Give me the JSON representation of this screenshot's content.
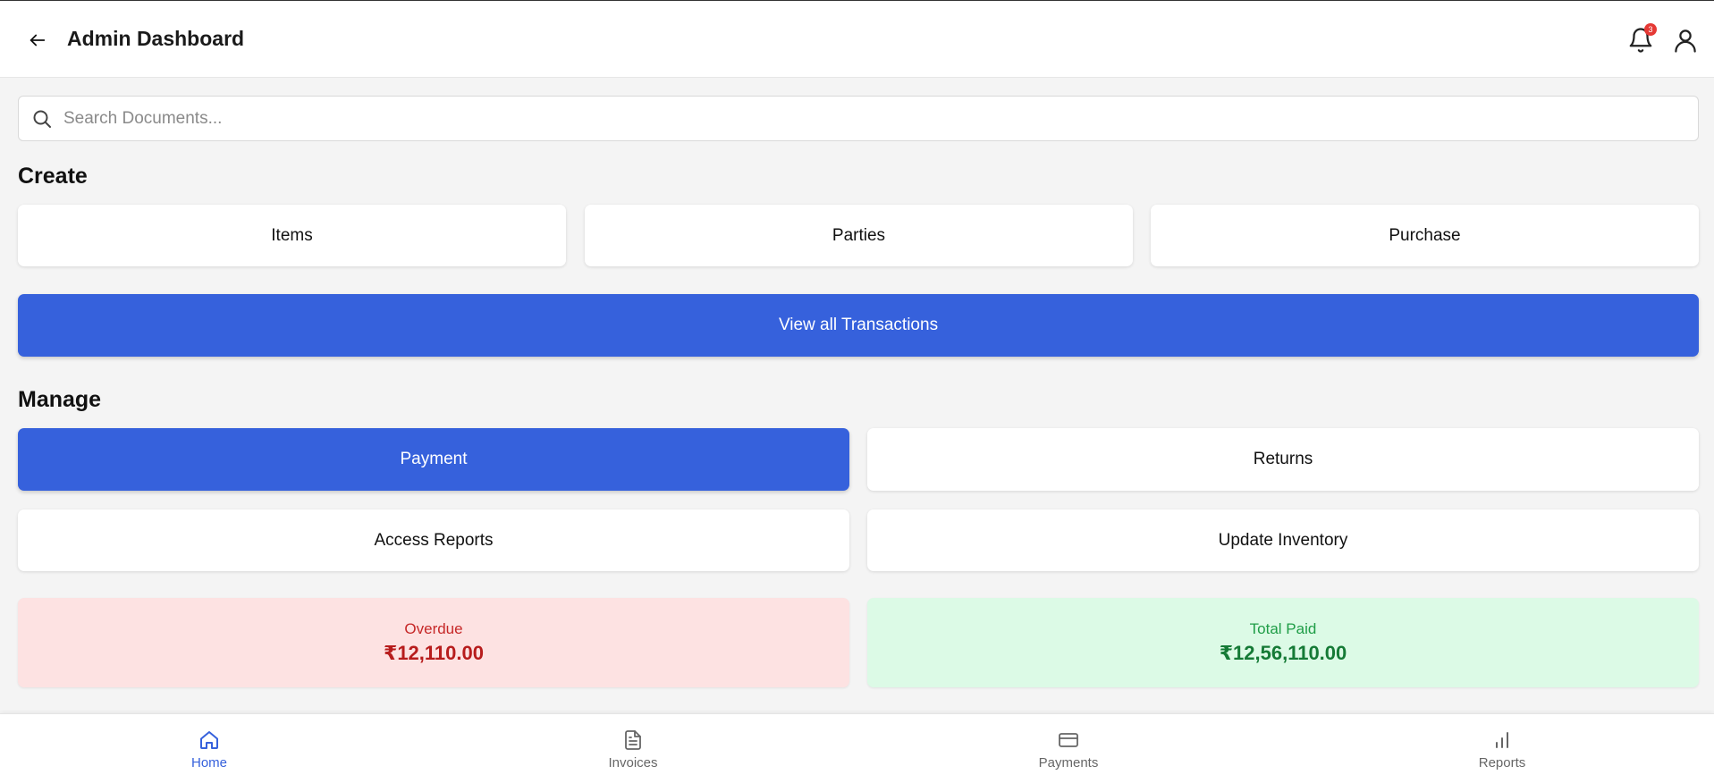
{
  "header": {
    "title": "Admin Dashboard",
    "back_icon": "arrow-left-icon",
    "notification_count": "3",
    "bell_icon": "bell-icon",
    "user_icon": "user-icon"
  },
  "search": {
    "placeholder": "Search Documents...",
    "value": "",
    "icon": "search-icon"
  },
  "create": {
    "title": "Create",
    "buttons": [
      "Items",
      "Parties",
      "Purchase"
    ],
    "view_all_label": "View all Transactions"
  },
  "manage": {
    "title": "Manage",
    "buttons": [
      "Payment",
      "Returns",
      "Access Reports",
      "Update Inventory"
    ]
  },
  "stats": {
    "overdue": {
      "label": "Overdue",
      "value": "₹12,110.00"
    },
    "total_paid": {
      "label": "Total Paid",
      "value": "₹12,56,110.00"
    }
  },
  "bottom_nav": {
    "items": [
      {
        "label": "Home",
        "icon": "home-icon",
        "active": true
      },
      {
        "label": "Invoices",
        "icon": "document-icon",
        "active": false
      },
      {
        "label": "Payments",
        "icon": "credit-card-icon",
        "active": false
      },
      {
        "label": "Reports",
        "icon": "bar-chart-icon",
        "active": false
      }
    ]
  },
  "colors": {
    "primary": "#3661dc",
    "overdue_bg": "#fde2e2",
    "overdue_text": "#b71c1c",
    "paid_bg": "#dcfae6",
    "paid_text": "#157a36",
    "badge": "#e53935"
  }
}
